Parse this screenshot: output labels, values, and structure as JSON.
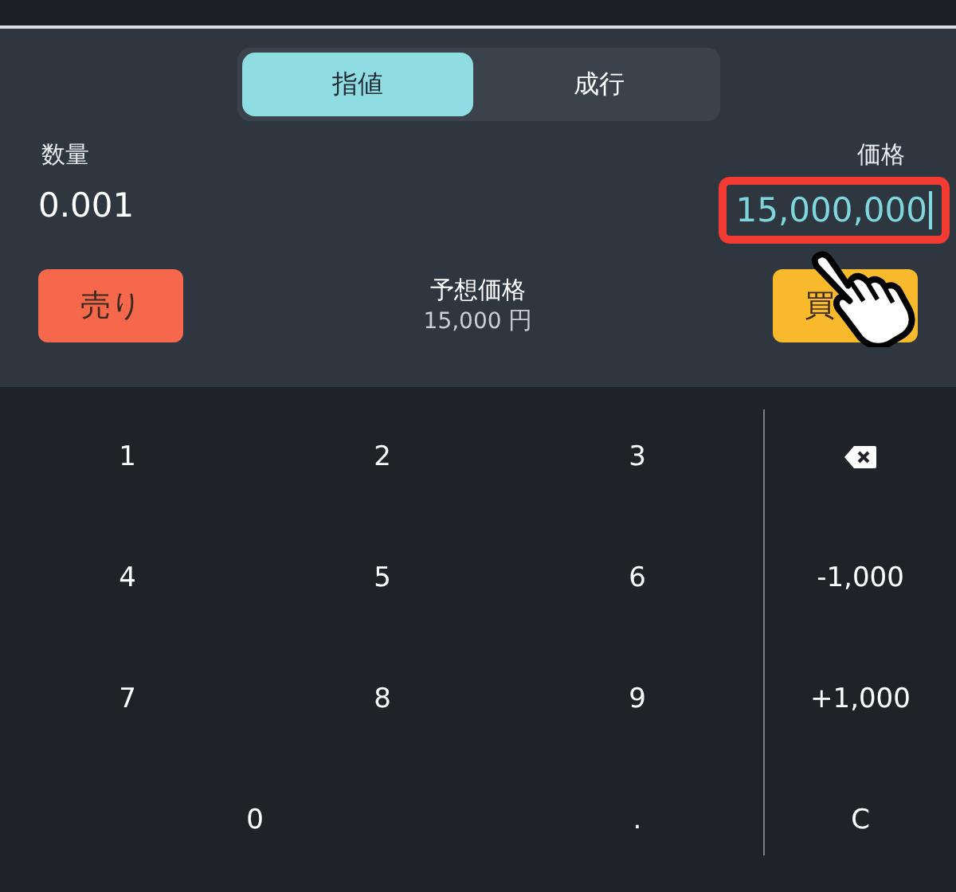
{
  "order_type_tabs": [
    {
      "label": "指値",
      "selected": true
    },
    {
      "label": "成行",
      "selected": false
    }
  ],
  "quantity": {
    "label": "数量",
    "value": "0.001"
  },
  "price": {
    "label": "価格",
    "value": "15,000,000",
    "focused": true
  },
  "sell_button": "売り",
  "estimate": {
    "label": "予想価格",
    "amount": "15,000",
    "unit": "円"
  },
  "buy_button": "買",
  "keypad": [
    [
      {
        "kind": "key",
        "label": "1"
      },
      {
        "kind": "key",
        "label": "2"
      },
      {
        "kind": "key",
        "label": "3"
      },
      {
        "kind": "backspace"
      }
    ],
    [
      {
        "kind": "key",
        "label": "4"
      },
      {
        "kind": "key",
        "label": "5"
      },
      {
        "kind": "key",
        "label": "6"
      },
      {
        "kind": "key",
        "label": "-1,000"
      }
    ],
    [
      {
        "kind": "key",
        "label": "7"
      },
      {
        "kind": "key",
        "label": "8"
      },
      {
        "kind": "key",
        "label": "9"
      },
      {
        "kind": "key",
        "label": "+1,000"
      }
    ],
    [
      {
        "kind": "wide",
        "label": "0"
      },
      {
        "kind": "key",
        "label": "."
      },
      {
        "kind": "key",
        "label": "C"
      }
    ]
  ]
}
